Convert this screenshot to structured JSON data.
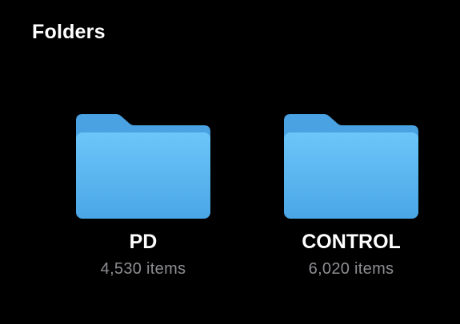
{
  "section": {
    "title": "Folders"
  },
  "folders": [
    {
      "name": "PD",
      "count": "4,530 items"
    },
    {
      "name": "CONTROL",
      "count": "6,020 items"
    }
  ],
  "colors": {
    "background": "#000000",
    "folder_top": "#6ac4f8",
    "folder_bottom": "#4aa6e6",
    "folder_tab": "#4aa2e2",
    "secondary_text": "#8e8e93"
  },
  "icons": {
    "folder": "folder-icon"
  }
}
